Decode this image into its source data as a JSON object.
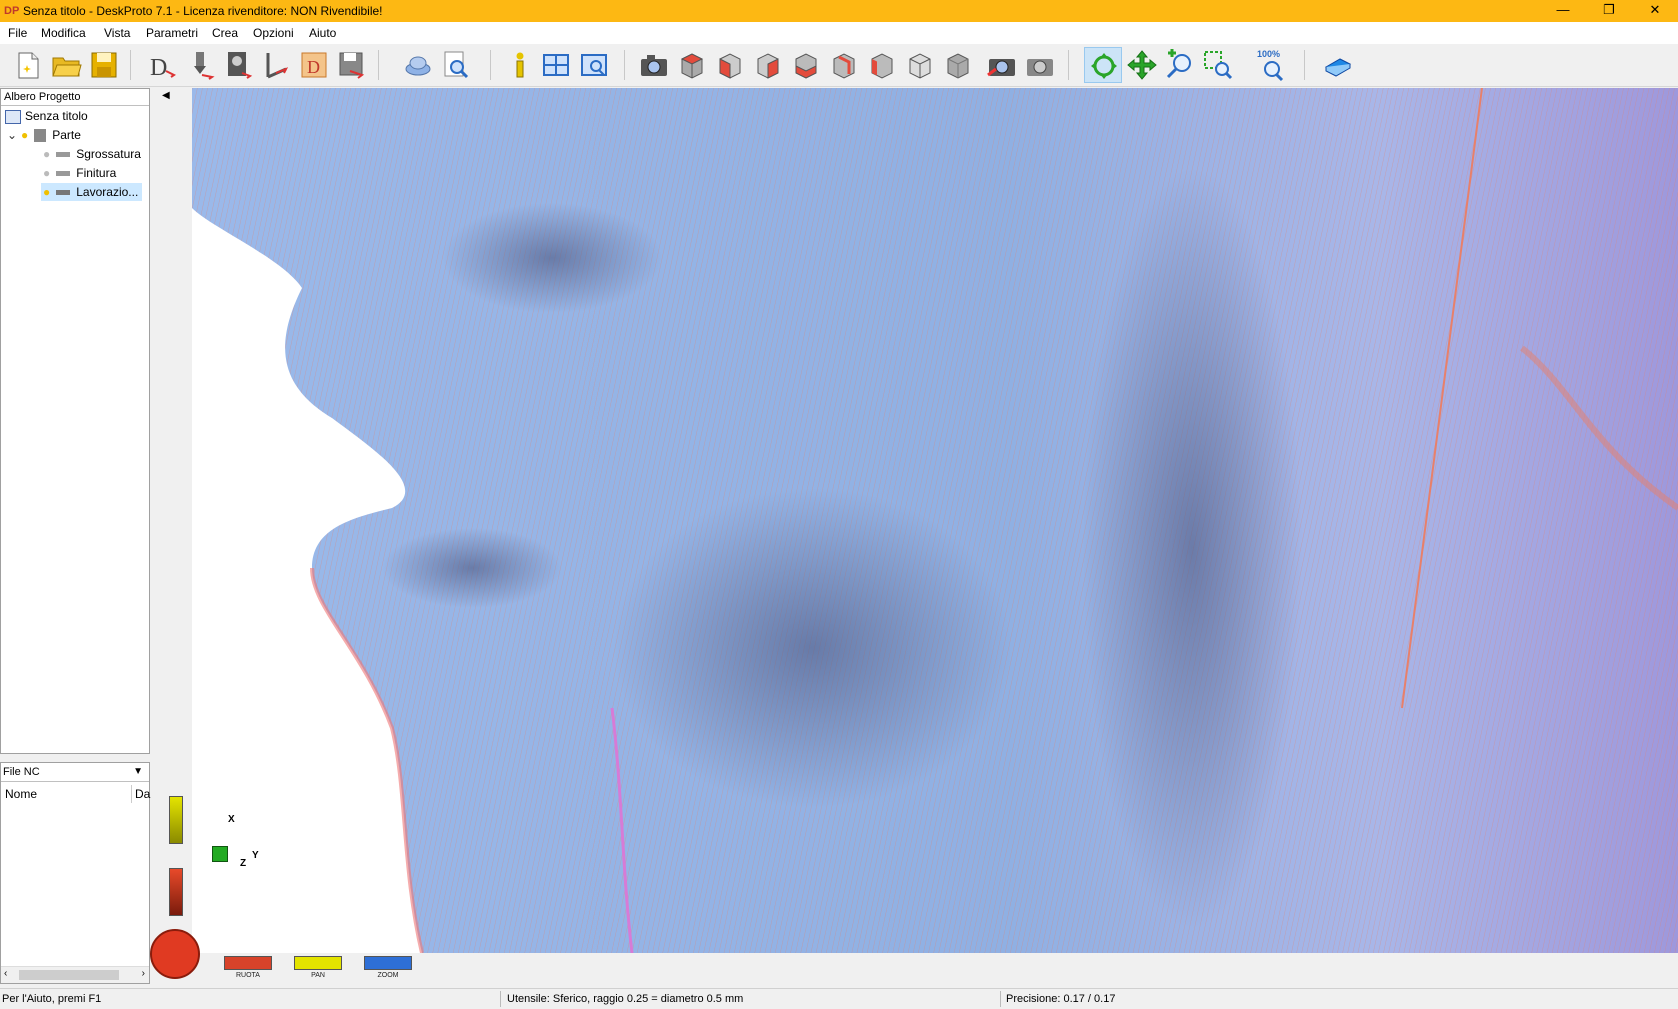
{
  "window": {
    "title": "Senza titolo - DeskProto 7.1 - Licenza rivenditore: NON Rivendibile!",
    "app_icon": "DP",
    "controls": {
      "minimize": "—",
      "restore": "❐",
      "close": "✕"
    },
    "title_bar_color": "#fdb813"
  },
  "menu": [
    "File",
    "Modifica",
    "Vista",
    "Parametri",
    "Crea",
    "Opzioni",
    "Aiuto"
  ],
  "toolbar": {
    "zoom_label": "100%",
    "buttons": [
      "new-file-icon",
      "open-folder-icon",
      "save-icon",
      "part-params-icon",
      "operation-params-icon",
      "bitmap-icon",
      "vector-icon",
      "create-nc-icon",
      "export-icon",
      "simulation-icon",
      "find-icon",
      "info-icon",
      "tile-view-icon",
      "viewports-icon",
      "camera-icon",
      "view-front-icon",
      "view-right-icon",
      "view-top-icon",
      "view-left-icon",
      "view-back-icon",
      "view-bottom-icon",
      "view-iso-icon",
      "view-box-icon",
      "camera-save-icon",
      "camera-load-icon",
      "rotate-icon",
      "pan-icon",
      "zoom-icon",
      "zoom-window-icon",
      "zoom-100-icon",
      "help-book-icon"
    ]
  },
  "tree": {
    "header": "Albero Progetto",
    "root": "Senza titolo",
    "part": "Parte",
    "items": [
      "Sgrossatura",
      "Finitura",
      "Lavorazio..."
    ]
  },
  "nc_panel": {
    "dropdown": "File NC",
    "col_name": "Nome",
    "col_date": "Da"
  },
  "view_controls": {
    "rotate": "RUOTA",
    "pan": "PAN",
    "zoom": "ZOOM",
    "axis_x": "X",
    "axis_y": "Y",
    "axis_z": "Z"
  },
  "status": {
    "help": "Per l'Aiuto, premi F1",
    "tool": "Utensile: Sferico, raggio 0.25 = diametro 0.5 mm",
    "precision": "Precisione: 0.17 / 0.17"
  },
  "colors": {
    "model_blue": "#8fb2e6",
    "toolpath_orange": "#e8806a",
    "toolpath_pink": "#d77bd6",
    "accent_active": "#cce4f7"
  }
}
